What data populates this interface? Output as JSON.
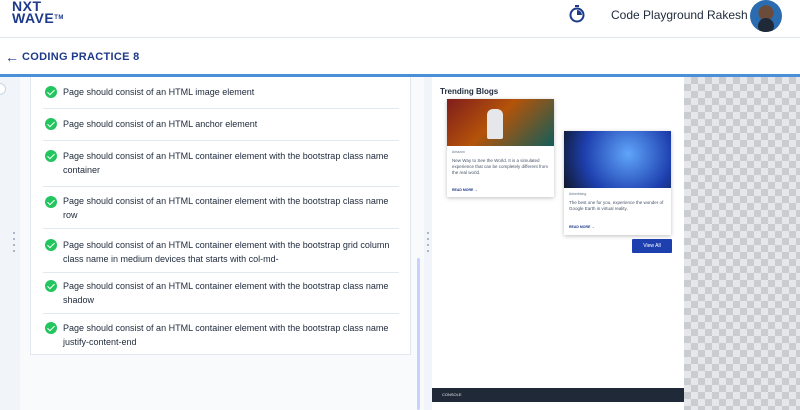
{
  "header": {
    "logo_line1": "NXT",
    "logo_line2": "WAVE",
    "logo_tm": "TM",
    "code_playground": "Code Playground",
    "username": "Rakesh"
  },
  "subheader": {
    "back_icon": "left-arrow-icon",
    "title": "CODING PRACTICE 8"
  },
  "tests": [
    "Page should consist of an HTML image element",
    "Page should consist of an HTML anchor element",
    "Page should consist of an HTML container element with the bootstrap class name container",
    "Page should consist of an HTML container element with the bootstrap class name row",
    "Page should consist of an HTML container element with the bootstrap grid column class name in medium devices that starts with col-md-",
    "Page should consist of an HTML container element with the bootstrap class name shadow",
    "Page should consist of an HTML container element with the bootstrap class name justify-content-end"
  ],
  "preview": {
    "heading": "Trending Blogs",
    "cards": [
      {
        "tag": "Amazon",
        "description": "New Way to See the World. It is a simulated experience that can be completely different from the real world.",
        "read_more": "READ MORE →"
      },
      {
        "tag": "Advertising",
        "description": "The best one for you, experience the wonder of Google Earth in virtual reality.",
        "read_more": "READ MORE →"
      }
    ],
    "view_all": "View All",
    "console": "CONSOLE"
  },
  "colors": {
    "brand": "#1e3a8a",
    "accent_rule": "#4a90d9",
    "success": "#22c55e",
    "button": "#1e40af"
  }
}
